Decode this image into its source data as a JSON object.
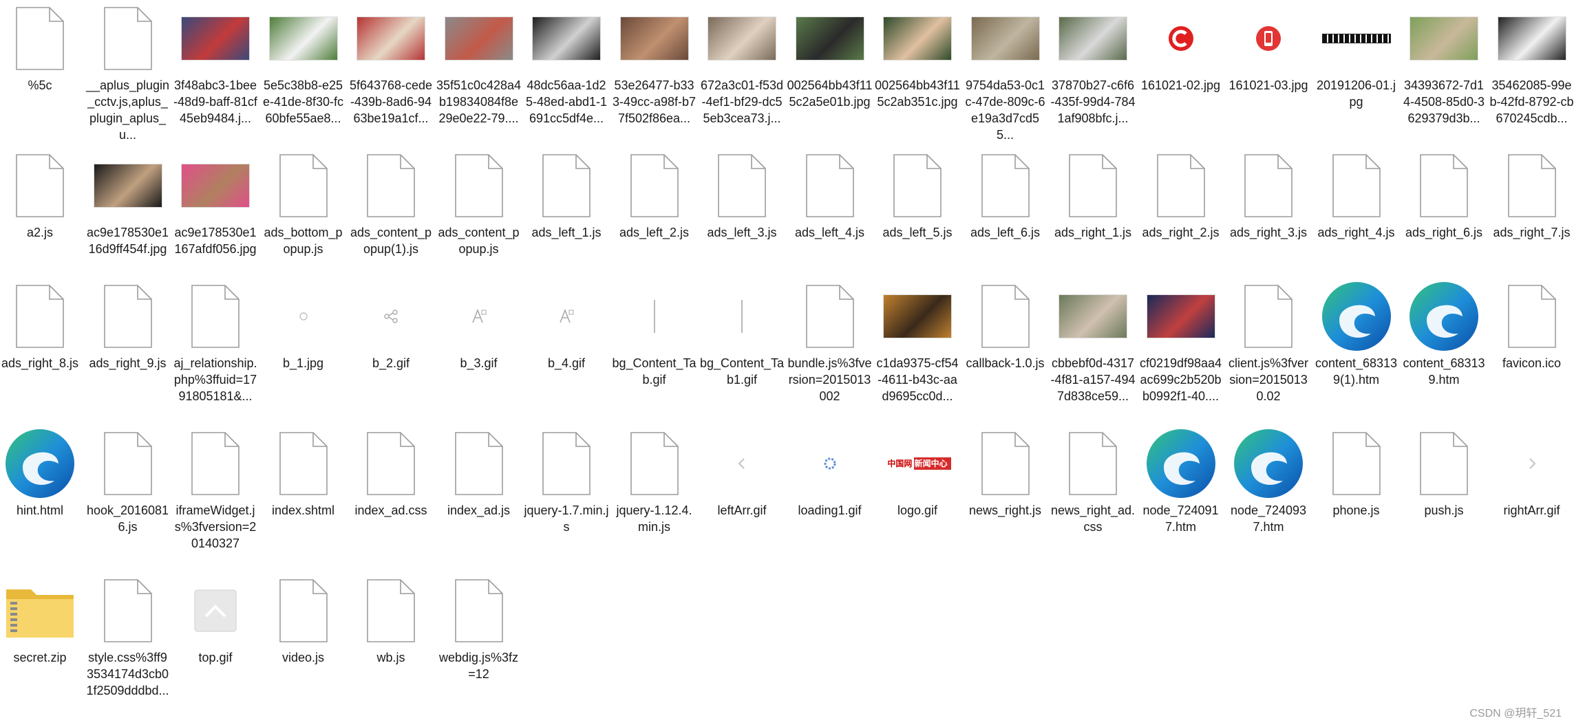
{
  "files": [
    {
      "label": "%5c",
      "icon": "blank-file-icon"
    },
    {
      "label": "__aplus_plugin_cctv.js,aplus_plugin_aplus_u...",
      "icon": "blank-file-icon"
    },
    {
      "label": "3f48abc3-1bee-48d9-baff-81cf45eb9484.j...",
      "icon": "photo-thumbnail",
      "colors": [
        "#3a4a7a",
        "#c23b3b"
      ]
    },
    {
      "label": "5e5c38b8-e25e-41de-8f30-fc60bfe55ae8...",
      "icon": "photo-thumbnail",
      "colors": [
        "#4f7d3a",
        "#f2f2f2"
      ]
    },
    {
      "label": "5f643768-cede-439b-8ad6-9463be19a1cf...",
      "icon": "photo-thumbnail",
      "colors": [
        "#b53434",
        "#e6d7c4"
      ]
    },
    {
      "label": "35f51c0c428a4b19834084f8e29e0e22-79....",
      "icon": "photo-thumbnail",
      "colors": [
        "#8a8a8a",
        "#c25a4a"
      ]
    },
    {
      "label": "48dc56aa-1d25-48ed-abd1-1691cc5df4e...",
      "icon": "photo-thumbnail",
      "colors": [
        "#1f1f1f",
        "#d0d0d0"
      ]
    },
    {
      "label": "53e26477-b333-49cc-a98f-b77f502f86ea...",
      "icon": "photo-thumbnail",
      "colors": [
        "#6a4a3a",
        "#c09070"
      ]
    },
    {
      "label": "672a3c01-f53d-4ef1-bf29-dc55eb3cea73.j...",
      "icon": "photo-thumbnail",
      "colors": [
        "#7a6a5a",
        "#e0d0c0"
      ]
    },
    {
      "label": "002564bb43f115c2a5e01b.jpg",
      "icon": "photo-thumbnail",
      "colors": [
        "#5a7a4a",
        "#2a2a2a"
      ]
    },
    {
      "label": "002564bb43f115c2ab351c.jpg",
      "icon": "photo-thumbnail",
      "colors": [
        "#2e4a2a",
        "#e0c0a0"
      ]
    },
    {
      "label": "9754da53-0c1c-47de-809c-6e19a3d7cd55...",
      "icon": "photo-thumbnail",
      "colors": [
        "#7a6a50",
        "#bfb5a0"
      ]
    },
    {
      "label": "37870b27-c6f6-435f-99d4-7841af908bfc.j...",
      "icon": "photo-thumbnail",
      "colors": [
        "#5a6a4a",
        "#d9d9d9"
      ]
    },
    {
      "label": "161021-02.jpg",
      "icon": "red-c-logo-icon"
    },
    {
      "label": "161021-03.jpg",
      "icon": "red-phone-icon"
    },
    {
      "label": "20191206-01.jpg",
      "icon": "banner-strip-icon"
    },
    {
      "label": "34393672-7d14-4508-85d0-3629379d3b...",
      "icon": "photo-thumbnail",
      "colors": [
        "#7ea05a",
        "#c8b89a"
      ]
    },
    {
      "label": "35462085-99eb-42fd-8792-cb670245cdb...",
      "icon": "photo-thumbnail",
      "colors": [
        "#222222",
        "#f0f0f0"
      ]
    },
    {
      "label": "a2.js",
      "icon": "blank-file-icon"
    },
    {
      "label": "ac9e178530e116d9ff454f.jpg",
      "icon": "photo-thumbnail",
      "colors": [
        "#1a1a1a",
        "#c0a080"
      ]
    },
    {
      "label": "ac9e178530e1167afdf056.jpg",
      "icon": "photo-thumbnail",
      "colors": [
        "#e0508a",
        "#b08060"
      ]
    },
    {
      "label": "ads_bottom_popup.js",
      "icon": "blank-file-icon"
    },
    {
      "label": "ads_content_popup(1).js",
      "icon": "blank-file-icon"
    },
    {
      "label": "ads_content_popup.js",
      "icon": "blank-file-icon"
    },
    {
      "label": "ads_left_1.js",
      "icon": "blank-file-icon"
    },
    {
      "label": "ads_left_2.js",
      "icon": "blank-file-icon"
    },
    {
      "label": "ads_left_3.js",
      "icon": "blank-file-icon"
    },
    {
      "label": "ads_left_4.js",
      "icon": "blank-file-icon"
    },
    {
      "label": "ads_left_5.js",
      "icon": "blank-file-icon"
    },
    {
      "label": "ads_left_6.js",
      "icon": "blank-file-icon"
    },
    {
      "label": "ads_right_1.js",
      "icon": "blank-file-icon"
    },
    {
      "label": "ads_right_2.js",
      "icon": "blank-file-icon"
    },
    {
      "label": "ads_right_3.js",
      "icon": "blank-file-icon"
    },
    {
      "label": "ads_right_4.js",
      "icon": "blank-file-icon"
    },
    {
      "label": "ads_right_6.js",
      "icon": "blank-file-icon"
    },
    {
      "label": "ads_right_7.js",
      "icon": "blank-file-icon"
    },
    {
      "label": "ads_right_8.js",
      "icon": "blank-file-icon"
    },
    {
      "label": "ads_right_9.js",
      "icon": "blank-file-icon"
    },
    {
      "label": "aj_relationship.php%3ffuid=1791805181&...",
      "icon": "blank-file-icon"
    },
    {
      "label": "b_1.jpg",
      "icon": "tiny-glyph-icon"
    },
    {
      "label": "b_2.gif",
      "icon": "share-glyph-icon"
    },
    {
      "label": "b_3.gif",
      "icon": "font-a-glyph-icon"
    },
    {
      "label": "b_4.gif",
      "icon": "font-a-glyph-icon"
    },
    {
      "label": "bg_Content_Tab.gif",
      "icon": "thin-line-icon"
    },
    {
      "label": "bg_Content_Tab1.gif",
      "icon": "thin-line-icon"
    },
    {
      "label": "bundle.js%3fversion=2015013002",
      "icon": "blank-file-icon"
    },
    {
      "label": "c1da9375-cf54-4611-b43c-aad9695cc0d...",
      "icon": "photo-thumbnail",
      "colors": [
        "#c08030",
        "#3a2a1a"
      ]
    },
    {
      "label": "callback-1.0.js",
      "icon": "blank-file-icon"
    },
    {
      "label": "cbbebf0d-4317-4f81-a157-4947d838ce59...",
      "icon": "photo-thumbnail",
      "colors": [
        "#6a7a5a",
        "#d0c0b0"
      ]
    },
    {
      "label": "cf0219df98aa4ac699c2b520bb0992f1-40....",
      "icon": "photo-thumbnail",
      "colors": [
        "#1a2a5a",
        "#c04040"
      ]
    },
    {
      "label": "client.js%3fversion=20150130.02",
      "icon": "blank-file-icon"
    },
    {
      "label": "content_683139(1).htm",
      "icon": "edge-icon"
    },
    {
      "label": "content_683139.htm",
      "icon": "edge-icon"
    },
    {
      "label": "favicon.ico",
      "icon": "blank-file-icon"
    },
    {
      "label": "hint.html",
      "icon": "edge-icon"
    },
    {
      "label": "hook_20160816.js",
      "icon": "blank-file-icon"
    },
    {
      "label": "iframeWidget.js%3fversion=20140327",
      "icon": "blank-file-icon"
    },
    {
      "label": "index.shtml",
      "icon": "blank-file-icon"
    },
    {
      "label": "index_ad.css",
      "icon": "blank-file-icon"
    },
    {
      "label": "index_ad.js",
      "icon": "blank-file-icon"
    },
    {
      "label": "jquery-1.7.min.js",
      "icon": "blank-file-icon"
    },
    {
      "label": "jquery-1.12.4.min.js",
      "icon": "blank-file-icon"
    },
    {
      "label": "leftArr.gif",
      "icon": "left-arrow-glyph-icon"
    },
    {
      "label": "loading1.gif",
      "icon": "loading-glyph-icon"
    },
    {
      "label": "logo.gif",
      "icon": "news-logo-icon",
      "logo_text": "中国网 新闻中心"
    },
    {
      "label": "news_right.js",
      "icon": "blank-file-icon"
    },
    {
      "label": "news_right_ad.css",
      "icon": "blank-file-icon"
    },
    {
      "label": "node_7240917.htm",
      "icon": "edge-icon"
    },
    {
      "label": "node_7240937.htm",
      "icon": "edge-icon"
    },
    {
      "label": "phone.js",
      "icon": "blank-file-icon"
    },
    {
      "label": "push.js",
      "icon": "blank-file-icon"
    },
    {
      "label": "rightArr.gif",
      "icon": "right-arrow-glyph-icon"
    },
    {
      "label": "secret.zip",
      "icon": "zip-folder-icon"
    },
    {
      "label": "style.css%3ff93534174d3cb01f2509dddbd...",
      "icon": "blank-file-icon"
    },
    {
      "label": "top.gif",
      "icon": "top-button-icon"
    },
    {
      "label": "video.js",
      "icon": "blank-file-icon"
    },
    {
      "label": "wb.js",
      "icon": "blank-file-icon"
    },
    {
      "label": "webdig.js%3fz=12",
      "icon": "blank-file-icon"
    }
  ],
  "watermark": "CSDN @玥轩_521"
}
